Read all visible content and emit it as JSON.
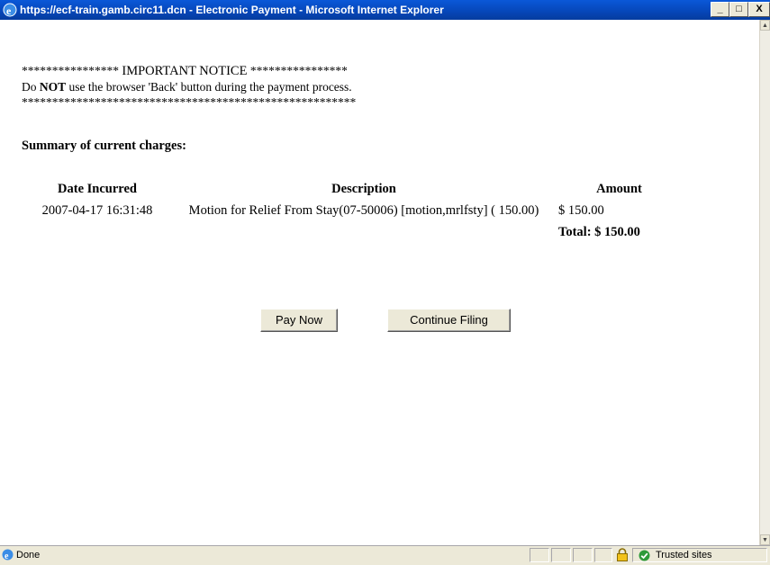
{
  "window": {
    "title": "https://ecf-train.gamb.circ11.dcn - Electronic Payment - Microsoft Internet Explorer",
    "controls": [
      "_",
      "□",
      "X"
    ]
  },
  "notice": {
    "line1_stars_left": "****************",
    "line1_title": "IMPORTANT NOTICE",
    "line1_stars_right": "****************",
    "line2_prefix": "Do ",
    "line2_bold": "NOT",
    "line2_suffix": " use the browser 'Back' button during the payment process.",
    "line3": "*******************************************************"
  },
  "summary_heading": "Summary of current charges:",
  "table": {
    "headers": [
      "Date Incurred",
      "Description",
      "Amount"
    ],
    "rows": [
      {
        "date": "2007-04-17 16:31:48",
        "description": "Motion for Relief From Stay(07-50006) [motion,mrlfsty] ( 150.00)",
        "amount": "$ 150.00"
      }
    ],
    "total": "Total: $ 150.00"
  },
  "buttons": {
    "pay_now": "Pay Now",
    "continue_filing": "Continue Filing"
  },
  "statusbar": {
    "status": "Done",
    "zone": "Trusted sites"
  },
  "colors": {
    "titlebar": "#0646b8",
    "chrome": "#ece9d8"
  }
}
